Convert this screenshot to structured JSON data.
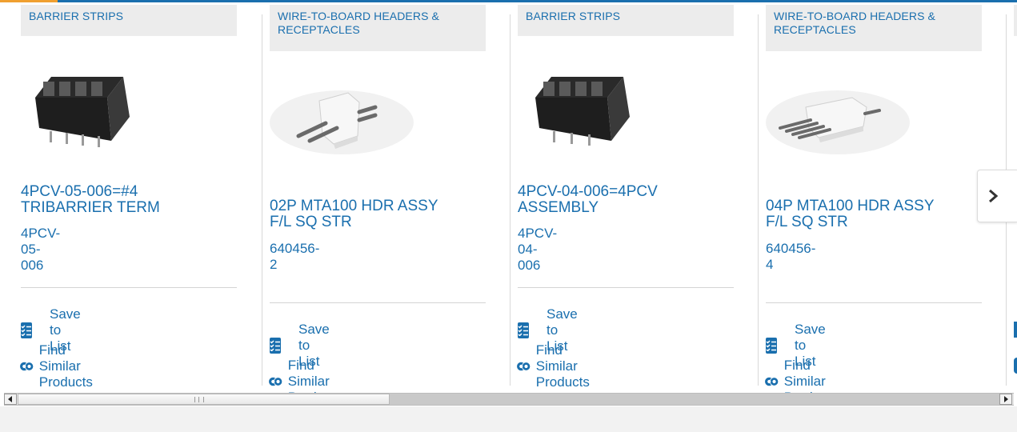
{
  "cards": [
    {
      "category": "BARRIER STRIPS",
      "title": "4PCV-05-006=#4 TRIBARRIER TERM",
      "part_number": "4PCV-05-006",
      "image_icon": "barrier-strip-image",
      "save_label": "Save to List",
      "similar_label": "Find Similar Products"
    },
    {
      "category": "WIRE-TO-BOARD HEADERS & RECEPTACLES",
      "title": "02P MTA100 HDR ASSY F/L SQ STR",
      "part_number": "640456-2",
      "image_icon": "header-connector-image",
      "save_label": "Save to List",
      "similar_label": "Find Similar Products"
    },
    {
      "category": "BARRIER STRIPS",
      "title": "4PCV-04-006=4PCV ASSEMBLY",
      "part_number": "4PCV-04-006",
      "image_icon": "barrier-strip-image",
      "save_label": "Save to List",
      "similar_label": "Find Similar Products"
    },
    {
      "category": "WIRE-TO-BOARD HEADERS & RECEPTACLES",
      "title": "04P MTA100 HDR ASSY F/L SQ STR",
      "part_number": "640456-4",
      "image_icon": "header-connector-image",
      "save_label": "Save to List",
      "similar_label": "Find Similar Products"
    }
  ],
  "carousel": {
    "next_label": "›"
  },
  "colors": {
    "link": "#1a6fae",
    "category_bg": "#ececec",
    "accent": "#f0a030"
  }
}
